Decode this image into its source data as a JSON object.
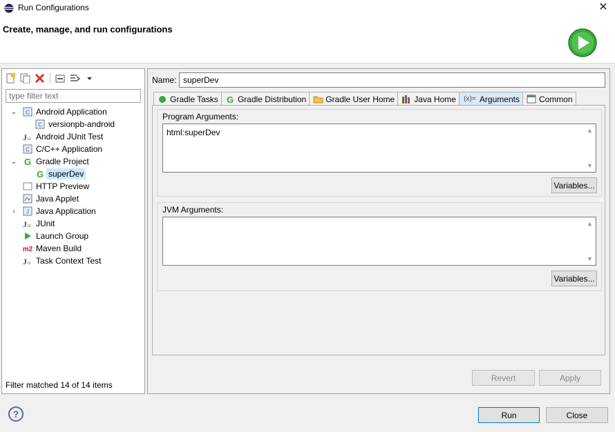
{
  "window": {
    "title": "Run Configurations",
    "close_glyph": "✕"
  },
  "header": {
    "subtitle": "Create, manage, and run configurations"
  },
  "left": {
    "filter_placeholder": "type filter text",
    "tree": [
      {
        "label": "Android Application",
        "level": 0,
        "expanded": true,
        "icon": "android-app-icon",
        "icon_text": "C"
      },
      {
        "label": "versionpb-android",
        "level": 1,
        "icon": "android-config-icon",
        "icon_text": "C"
      },
      {
        "label": "Android JUnit Test",
        "level": 0,
        "icon": "junit-icon",
        "icon_text": "Ju"
      },
      {
        "label": "C/C++ Application",
        "level": 0,
        "icon": "cpp-app-icon",
        "icon_text": "C"
      },
      {
        "label": "Gradle Project",
        "level": 0,
        "expanded": true,
        "icon": "gradle-icon",
        "icon_text": "G"
      },
      {
        "label": "superDev",
        "level": 1,
        "selected": true,
        "icon": "gradle-icon",
        "icon_text": "G"
      },
      {
        "label": "HTTP Preview",
        "level": 0,
        "icon": "http-preview-icon",
        "icon_text": ""
      },
      {
        "label": "Java Applet",
        "level": 0,
        "icon": "java-applet-icon",
        "icon_text": ""
      },
      {
        "label": "Java Application",
        "level": 0,
        "collapsed": true,
        "icon": "java-app-icon",
        "icon_text": "J"
      },
      {
        "label": "JUnit",
        "level": 0,
        "icon": "junit-icon",
        "icon_text": "Ju"
      },
      {
        "label": "Launch Group",
        "level": 0,
        "icon": "launch-group-icon",
        "icon_text": "▶"
      },
      {
        "label": "Maven Build",
        "level": 0,
        "icon": "maven-icon",
        "icon_text": "m2"
      },
      {
        "label": "Task Context Test",
        "level": 0,
        "icon": "task-context-test-icon",
        "icon_text": "Ju"
      }
    ],
    "status": "Filter matched 14 of 14 items"
  },
  "right": {
    "name_label": "Name:",
    "name_value": "superDev",
    "tabs": [
      {
        "label": "Gradle Tasks",
        "icon": "gradle-tasks-icon"
      },
      {
        "label": "Gradle Distribution",
        "icon": "gradle-icon"
      },
      {
        "label": "Gradle User Home",
        "icon": "folder-icon"
      },
      {
        "label": "Java Home",
        "icon": "java-home-icon"
      },
      {
        "label": "Arguments",
        "icon": "arguments-icon",
        "icon_text": "(x)=",
        "active": true
      },
      {
        "label": "Common",
        "icon": "common-icon"
      }
    ],
    "program_args": {
      "label": "Program Arguments:",
      "value": "html:superDev",
      "variables_label": "Variables..."
    },
    "jvm_args": {
      "label": "JVM Arguments:",
      "value": "",
      "variables_label": "Variables..."
    },
    "revert_label": "Revert",
    "apply_label": "Apply"
  },
  "footer": {
    "help_glyph": "?",
    "run_label": "Run",
    "close_label": "Close"
  },
  "colors": {
    "accent": "#0078d7",
    "selection": "#cce8ff",
    "gradle_green": "#3aa83a",
    "delete_red": "#d9302b"
  }
}
